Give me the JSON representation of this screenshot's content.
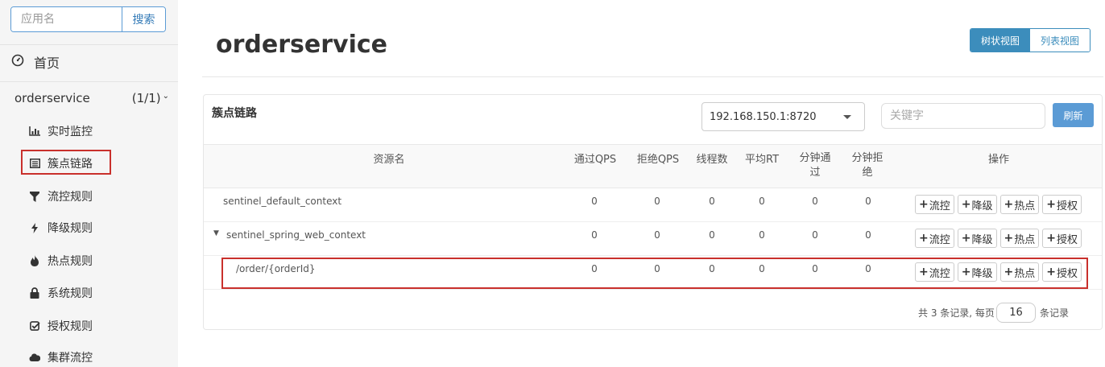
{
  "sidebar": {
    "search": {
      "placeholder": "应用名",
      "button_label": "搜索"
    },
    "home_label": "首页",
    "app": {
      "name": "orderservice",
      "count": "(1/1)"
    },
    "items": [
      {
        "label": "实时监控",
        "icon": "bar-chart-icon"
      },
      {
        "label": "簇点链路",
        "icon": "list-alt-icon"
      },
      {
        "label": "流控规则",
        "icon": "filter-icon"
      },
      {
        "label": "降级规则",
        "icon": "flash-icon"
      },
      {
        "label": "热点规则",
        "icon": "fire-icon"
      },
      {
        "label": "系统规则",
        "icon": "lock-icon"
      },
      {
        "label": "授权规则",
        "icon": "check-square-icon"
      },
      {
        "label": "集群流控",
        "icon": "cloud-icon"
      }
    ]
  },
  "header": {
    "title": "orderservice",
    "view_toggle": {
      "tree_label": "树状视图",
      "list_label": "列表视图",
      "active": "tree"
    }
  },
  "panel": {
    "title": "簇点链路",
    "machine_select": {
      "selected": "192.168.150.1:8720"
    },
    "keyword_input": {
      "placeholder": "关键字",
      "value": ""
    },
    "refresh_label": "刷新",
    "columns": {
      "resource": "资源名",
      "pass_qps": "通过QPS",
      "block_qps": "拒绝QPS",
      "threads": "线程数",
      "avg_rt": "平均RT",
      "minute_pass": "分钟通过",
      "minute_block": "分钟拒绝",
      "ops": "操作"
    },
    "op_labels": {
      "flow": "流控",
      "degrade": "降级",
      "hotspot": "热点",
      "auth": "授权"
    },
    "rows": [
      {
        "name": "sentinel_default_context",
        "values": [
          "0",
          "0",
          "0",
          "0",
          "0",
          "0"
        ]
      },
      {
        "name": "sentinel_spring_web_context",
        "values": [
          "0",
          "0",
          "0",
          "0",
          "0",
          "0"
        ]
      },
      {
        "name": "/order/{orderId}",
        "values": [
          "0",
          "0",
          "0",
          "0",
          "0",
          "0"
        ]
      }
    ],
    "footer": {
      "summary": "共 3 条记录, 每页",
      "page_size": "16",
      "suffix": "条记录"
    }
  },
  "colors": {
    "accent": "#3c8dbc",
    "button_blue": "#5b9bd5",
    "highlight_red": "#c9302c"
  }
}
